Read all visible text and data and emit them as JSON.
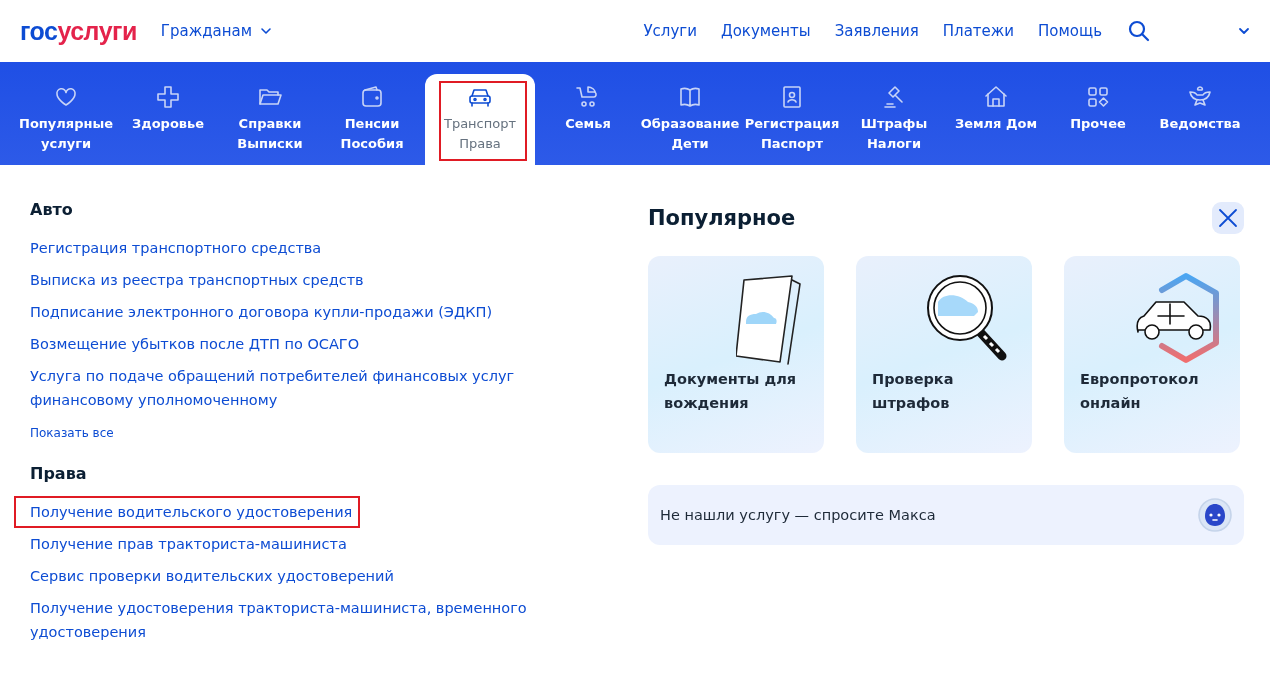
{
  "header": {
    "logo": {
      "prefix": "гос",
      "suffix": "услуги"
    },
    "audience": "Гражданам",
    "links": [
      "Услуги",
      "Документы",
      "Заявления",
      "Платежи",
      "Помощь"
    ]
  },
  "categories": [
    {
      "label": "Популярные услуги",
      "selected": false,
      "highlighted": false
    },
    {
      "label": "Здоровье",
      "selected": false,
      "highlighted": false
    },
    {
      "label": "Справки Выписки",
      "selected": false,
      "highlighted": false
    },
    {
      "label": "Пенсии Пособия",
      "selected": false,
      "highlighted": false
    },
    {
      "label": "Транспорт Права",
      "selected": true,
      "highlighted": true
    },
    {
      "label": "Семья",
      "selected": false,
      "highlighted": false
    },
    {
      "label": "Образование Дети",
      "selected": false,
      "highlighted": false
    },
    {
      "label": "Регистрация Паспорт",
      "selected": false,
      "highlighted": false
    },
    {
      "label": "Штрафы Налоги",
      "selected": false,
      "highlighted": false
    },
    {
      "label": "Земля Дом",
      "selected": false,
      "highlighted": false
    },
    {
      "label": "Прочее",
      "selected": false,
      "highlighted": false
    },
    {
      "label": "Ведомства",
      "selected": false,
      "highlighted": false
    }
  ],
  "sections": [
    {
      "title": "Авто",
      "links": [
        {
          "text": "Регистрация транспортного средства",
          "highlighted": false
        },
        {
          "text": "Выписка из реестра транспортных средств",
          "highlighted": false
        },
        {
          "text": "Подписание электронного договора купли-продажи (ЭДКП)",
          "highlighted": false
        },
        {
          "text": "Возмещение убытков после ДТП по ОСАГО",
          "highlighted": false
        },
        {
          "text": "Услуга по подаче обращений потребителей финансовых услуг финансовому уполномоченному",
          "highlighted": false
        }
      ],
      "show_all": "Показать все"
    },
    {
      "title": "Права",
      "links": [
        {
          "text": "Получение водительского удостоверения",
          "highlighted": true
        },
        {
          "text": "Получение прав тракториста-машиниста",
          "highlighted": false
        },
        {
          "text": "Сервис проверки водительских удостоверений",
          "highlighted": false
        },
        {
          "text": "Получение удостоверения тракториста-машиниста, временного удостоверения",
          "highlighted": false
        }
      ]
    }
  ],
  "popular": {
    "title": "Популярное",
    "cards": [
      {
        "kind": "document",
        "title": "Документы для вождения"
      },
      {
        "kind": "magnifier",
        "title": "Проверка штрафов"
      },
      {
        "kind": "hexagon",
        "title": "Европротокол онлайн"
      }
    ],
    "assistant": {
      "text": "Не нашли услугу — спросите Макса"
    }
  }
}
